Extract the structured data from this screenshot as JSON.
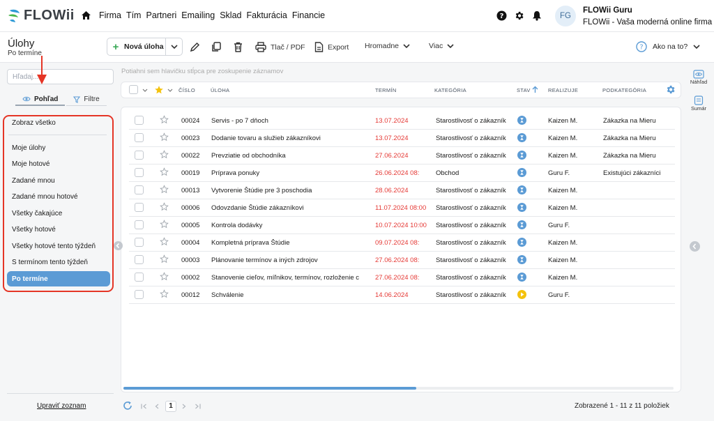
{
  "brand": {
    "logo_text": "FLOWii"
  },
  "nav": {
    "items": [
      "Firma",
      "Tím",
      "Partneri",
      "Emailing",
      "Sklad",
      "Fakturácia",
      "Financie"
    ]
  },
  "user": {
    "initials": "FG",
    "name": "FLOWii Guru",
    "company": "FLOWii - Vaša moderná online firma"
  },
  "page": {
    "title": "Úlohy",
    "subtitle": "Po termíne"
  },
  "toolbar": {
    "new_label": "Nová úloha",
    "print_label": "Tlač / PDF",
    "export_label": "Export",
    "bulk_label": "Hromadne",
    "more_label": "Viac",
    "help_label": "Ako na to?"
  },
  "sidebar": {
    "search_placeholder": "Hľadaj...",
    "tab_view": "Pohľad",
    "tab_filter": "Filtre",
    "views": [
      "Zobraz všetko",
      "Moje úlohy",
      "Moje hotové",
      "Zadané mnou",
      "Zadané mnou hotové",
      "Všetky čakajúce",
      "Všetky hotové",
      "Všetky hotové tento týždeň",
      "S termínom tento týždeň",
      "Po termíne"
    ],
    "edit_list": "Upraviť zoznam"
  },
  "grid": {
    "group_hint": "Potiahni sem hlavičku stĺpca pre zoskupenie záznamov",
    "columns": {
      "number": "ČÍSLO",
      "task": "ÚLOHA",
      "deadline": "TERMÍN",
      "category": "KATEGÓRIA",
      "status": "STAV",
      "assignee": "REALIZUJE",
      "subcategory": "PODKATEGÓRIA"
    },
    "rows": [
      {
        "number": "00024",
        "task": "Servis - po 7 dňoch",
        "deadline": "13.07.2024",
        "category": "Starostlivosť o zákazník",
        "status": "waiting",
        "assignee": "Kaizen M.",
        "subcategory": "Zákazka na Mieru"
      },
      {
        "number": "00023",
        "task": "Dodanie tovaru a služieb zákazníkovi",
        "deadline": "13.07.2024",
        "category": "Starostlivosť o zákazník",
        "status": "waiting",
        "assignee": "Kaizen M.",
        "subcategory": "Zákazka na Mieru"
      },
      {
        "number": "00022",
        "task": "Prevziatie od obchodníka",
        "deadline": "27.06.2024",
        "category": "Starostlivosť o zákazník",
        "status": "waiting",
        "assignee": "Kaizen M.",
        "subcategory": "Zákazka na Mieru"
      },
      {
        "number": "00019",
        "task": "Príprava ponuky",
        "deadline": "26.06.2024 08:",
        "category": "Obchod",
        "status": "waiting",
        "assignee": "Guru F.",
        "subcategory": "Existujúci zákazníci"
      },
      {
        "number": "00013",
        "task": "Vytvorenie Štúdie pre 3 poschodia",
        "deadline": "28.06.2024",
        "category": "Starostlivosť o zákazník",
        "status": "waiting",
        "assignee": "Kaizen M.",
        "subcategory": ""
      },
      {
        "number": "00006",
        "task": "Odovzdanie Štúdie zákazníkovi",
        "deadline": "11.07.2024 08:00",
        "category": "Starostlivosť o zákazník",
        "status": "waiting",
        "assignee": "Kaizen M.",
        "subcategory": ""
      },
      {
        "number": "00005",
        "task": "Kontrola dodávky",
        "deadline": "10.07.2024 10:00",
        "category": "Starostlivosť o zákazník",
        "status": "waiting",
        "assignee": "Guru F.",
        "subcategory": ""
      },
      {
        "number": "00004",
        "task": "Kompletná príprava Štúdie",
        "deadline": "09.07.2024 08:",
        "category": "Starostlivosť o zákazník",
        "status": "waiting",
        "assignee": "Kaizen M.",
        "subcategory": ""
      },
      {
        "number": "00003",
        "task": "Plánovanie termínov a iných zdrojov",
        "deadline": "27.06.2024 08:",
        "category": "Starostlivosť o zákazník",
        "status": "waiting",
        "assignee": "Kaizen M.",
        "subcategory": ""
      },
      {
        "number": "00002",
        "task": "Stanovenie cieľov, míľnikov, termínov, rozloženie c",
        "deadline": "27.06.2024 08:",
        "category": "Starostlivosť o zákazník",
        "status": "waiting",
        "assignee": "Kaizen M.",
        "subcategory": ""
      },
      {
        "number": "00012",
        "task": "Schválenie",
        "deadline": "14.06.2024",
        "category": "Starostlivosť o zákazník",
        "status": "in-progress",
        "assignee": "Guru F.",
        "subcategory": ""
      }
    ]
  },
  "right_panel": {
    "preview": "Náhľad",
    "summary": "Sumár"
  },
  "pager": {
    "current": "1",
    "status": "Zobrazené 1 - 11 z 11 položiek"
  },
  "colors": {
    "accent": "#5b9bd5",
    "overdue": "#e53935",
    "highlight": "#e53526",
    "waiting": "#5b9bd5",
    "in_progress": "#f4c20d"
  }
}
